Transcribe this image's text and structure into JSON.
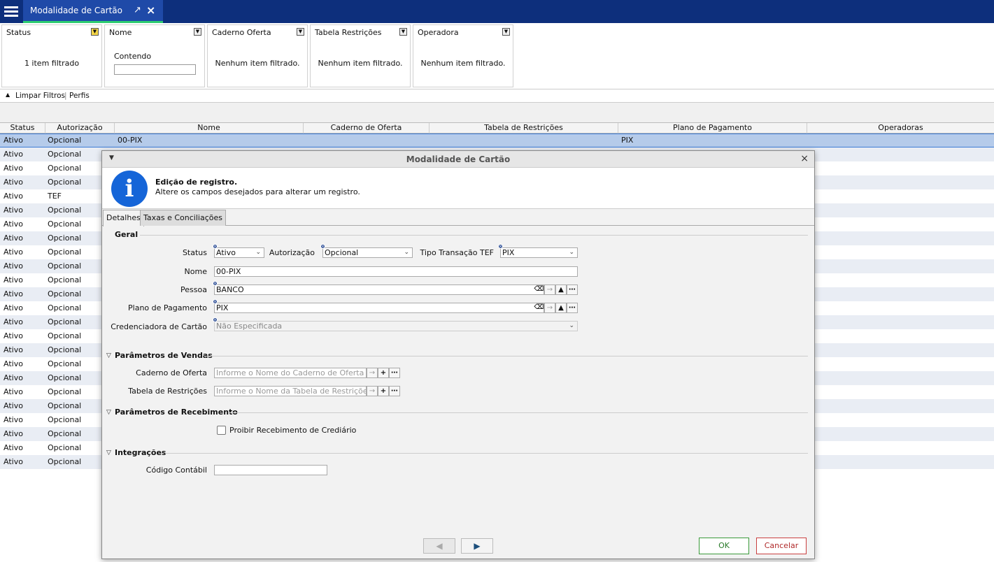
{
  "app": {
    "tab_title": "Modalidade de Cartão"
  },
  "filters": [
    {
      "title": "Status",
      "value": "1 item filtrado"
    },
    {
      "title": "Nome",
      "sub": "Contendo",
      "input": ""
    },
    {
      "title": "Caderno Oferta",
      "value": "Nenhum item filtrado."
    },
    {
      "title": "Tabela Restrições",
      "value": "Nenhum item filtrado."
    },
    {
      "title": "Operadora",
      "value": "Nenhum item filtrado."
    }
  ],
  "filterbar": {
    "clear": "Limpar Filtros",
    "sep": "|",
    "profiles": "Perfis"
  },
  "grid": {
    "columns": [
      "Status",
      "Autorização",
      "Nome",
      "Caderno de Oferta",
      "Tabela de Restrições",
      "Plano de Pagamento",
      "Operadoras"
    ],
    "rows": [
      {
        "status": "Ativo",
        "auth": "Opcional",
        "nome": "00-PIX",
        "plano": "PIX"
      },
      {
        "status": "Ativo",
        "auth": "Opcional"
      },
      {
        "status": "Ativo",
        "auth": "Opcional"
      },
      {
        "status": "Ativo",
        "auth": "Opcional"
      },
      {
        "status": "Ativo",
        "auth": "TEF"
      },
      {
        "status": "Ativo",
        "auth": "Opcional"
      },
      {
        "status": "Ativo",
        "auth": "Opcional"
      },
      {
        "status": "Ativo",
        "auth": "Opcional"
      },
      {
        "status": "Ativo",
        "auth": "Opcional"
      },
      {
        "status": "Ativo",
        "auth": "Opcional"
      },
      {
        "status": "Ativo",
        "auth": "Opcional"
      },
      {
        "status": "Ativo",
        "auth": "Opcional"
      },
      {
        "status": "Ativo",
        "auth": "Opcional"
      },
      {
        "status": "Ativo",
        "auth": "Opcional"
      },
      {
        "status": "Ativo",
        "auth": "Opcional"
      },
      {
        "status": "Ativo",
        "auth": "Opcional"
      },
      {
        "status": "Ativo",
        "auth": "Opcional"
      },
      {
        "status": "Ativo",
        "auth": "Opcional"
      },
      {
        "status": "Ativo",
        "auth": "Opcional"
      },
      {
        "status": "Ativo",
        "auth": "Opcional"
      },
      {
        "status": "Ativo",
        "auth": "Opcional"
      },
      {
        "status": "Ativo",
        "auth": "Opcional"
      },
      {
        "status": "Ativo",
        "auth": "Opcional"
      },
      {
        "status": "Ativo",
        "auth": "Opcional"
      }
    ]
  },
  "dialog": {
    "title": "Modalidade de Cartão",
    "info_title": "Edição de registro.",
    "info_sub": "Altere os campos desejados para alterar um registro.",
    "tabs": [
      "Detalhes",
      "Taxas e Conciliações"
    ],
    "geral": {
      "title": "Geral",
      "status_label": "Status",
      "status_value": "Ativo",
      "auth_label": "Autorização",
      "auth_value": "Opcional",
      "tef_label": "Tipo Transação TEF",
      "tef_value": "PIX",
      "nome_label": "Nome",
      "nome_value": "00-PIX",
      "pessoa_label": "Pessoa",
      "pessoa_value": "BANCO",
      "plano_label": "Plano de Pagamento",
      "plano_value": "PIX",
      "cred_label": "Credenciadora de Cartão",
      "cred_value": "Não Especificada"
    },
    "vendas": {
      "title": "Parâmetros de Vendas",
      "caderno_label": "Caderno de Oferta",
      "caderno_placeholder": "Informe o Nome do Caderno de Oferta",
      "tabela_label": "Tabela de Restrições",
      "tabela_placeholder": "Informe o Nome da Tabela de Restriçõe"
    },
    "recebimento": {
      "title": "Parâmetros de Recebimento",
      "proibir_label": "Proibir Recebimento de Crediário"
    },
    "integracoes": {
      "title": "Integrações",
      "codigo_label": "Código Contábil",
      "codigo_value": ""
    },
    "ok": "OK",
    "cancel": "Cancelar"
  }
}
